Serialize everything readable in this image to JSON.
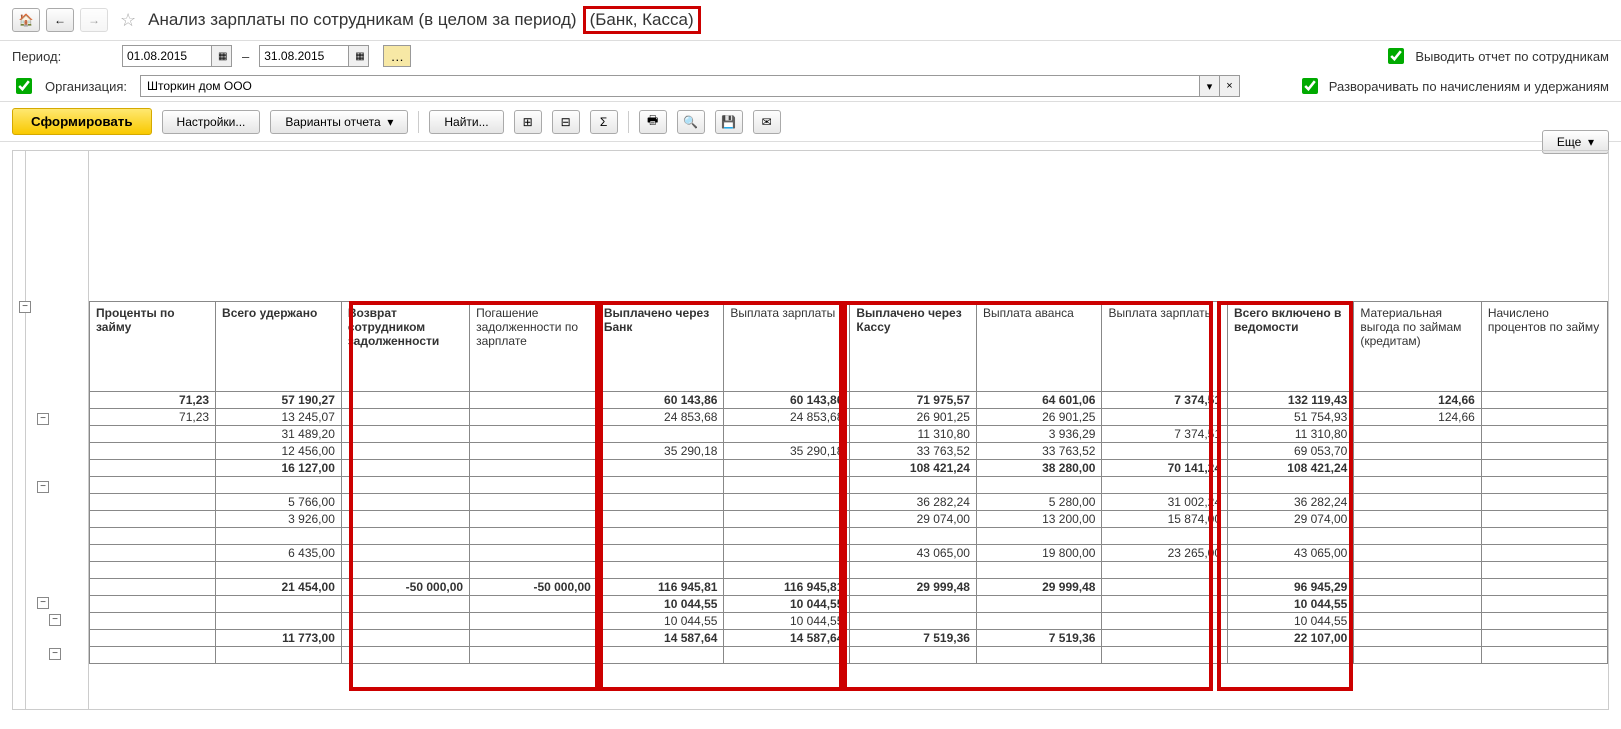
{
  "header": {
    "title_main": "Анализ зарплаты по сотрудникам (в целом за период)",
    "title_suffix": "(Банк, Касса)"
  },
  "period": {
    "label": "Период:",
    "from": "01.08.2015",
    "dash": "–",
    "to": "31.08.2015"
  },
  "org": {
    "label": "Организация:",
    "value": "Шторкин дом ООО"
  },
  "opts": {
    "by_emp": "Выводить отчет по сотрудникам",
    "expand": "Разворачивать по начислениям и удержаниям"
  },
  "actions": {
    "form": "Сформировать",
    "settings": "Настройки...",
    "variants": "Варианты отчета",
    "find": "Найти...",
    "more": "Еще"
  },
  "cols": [
    "Проценты по займу",
    "Всего удержано",
    "Возврат сотрудником задолженности",
    "Погашение задолженности по зарплате",
    "Выплачено через Банк",
    "Выплата зарплаты",
    "Выплачено через Кассу",
    "Выплата аванса",
    "Выплата зарплаты",
    "Всего включено в ведомости",
    "Материальная выгода по займам (кредитам)",
    "Начислено процентов по займу"
  ],
  "col_bold": [
    true,
    true,
    true,
    false,
    true,
    false,
    true,
    false,
    false,
    true,
    false,
    false
  ],
  "rows": [
    {
      "b": 1,
      "c": [
        "71,23",
        "57 190,27",
        "",
        "",
        "60 143,86",
        "60 143,86",
        "71 975,57",
        "64 601,06",
        "7 374,51",
        "132 119,43",
        "124,66",
        ""
      ]
    },
    {
      "b": 0,
      "c": [
        "71,23",
        "13 245,07",
        "",
        "",
        "24 853,68",
        "24 853,68",
        "26 901,25",
        "26 901,25",
        "",
        "51 754,93",
        "124,66",
        ""
      ]
    },
    {
      "b": 0,
      "c": [
        "",
        "31 489,20",
        "",
        "",
        "",
        "",
        "11 310,80",
        "3 936,29",
        "7 374,51",
        "11 310,80",
        "",
        ""
      ]
    },
    {
      "b": 0,
      "c": [
        "",
        "12 456,00",
        "",
        "",
        "35 290,18",
        "35 290,18",
        "33 763,52",
        "33 763,52",
        "",
        "69 053,70",
        "",
        ""
      ]
    },
    {
      "b": 1,
      "c": [
        "",
        "16 127,00",
        "",
        "",
        "",
        "",
        "108 421,24",
        "38 280,00",
        "70 141,24",
        "108 421,24",
        "",
        ""
      ]
    },
    {
      "b": 0,
      "c": [
        "",
        "",
        "",
        "",
        "",
        "",
        "",
        "",
        "",
        "",
        "",
        ""
      ]
    },
    {
      "b": 0,
      "c": [
        "",
        "5 766,00",
        "",
        "",
        "",
        "",
        "36 282,24",
        "5 280,00",
        "31 002,24",
        "36 282,24",
        "",
        ""
      ]
    },
    {
      "b": 0,
      "c": [
        "",
        "3 926,00",
        "",
        "",
        "",
        "",
        "29 074,00",
        "13 200,00",
        "15 874,00",
        "29 074,00",
        "",
        ""
      ]
    },
    {
      "b": 0,
      "c": [
        "",
        "",
        "",
        "",
        "",
        "",
        "",
        "",
        "",
        "",
        "",
        ""
      ]
    },
    {
      "b": 0,
      "c": [
        "",
        "6 435,00",
        "",
        "",
        "",
        "",
        "43 065,00",
        "19 800,00",
        "23 265,00",
        "43 065,00",
        "",
        ""
      ]
    },
    {
      "b": 0,
      "c": [
        "",
        "",
        "",
        "",
        "",
        "",
        "",
        "",
        "",
        "",
        "",
        ""
      ]
    },
    {
      "b": 1,
      "c": [
        "",
        "21 454,00",
        "-50 000,00",
        "-50 000,00",
        "116 945,81",
        "116 945,81",
        "29 999,48",
        "29 999,48",
        "",
        "96 945,29",
        "",
        ""
      ]
    },
    {
      "b": 1,
      "c": [
        "",
        "",
        "",
        "",
        "10 044,55",
        "10 044,55",
        "",
        "",
        "",
        "10 044,55",
        "",
        ""
      ]
    },
    {
      "b": 0,
      "c": [
        "",
        "",
        "",
        "",
        "10 044,55",
        "10 044,55",
        "",
        "",
        "",
        "10 044,55",
        "",
        ""
      ]
    },
    {
      "b": 1,
      "c": [
        "",
        "11 773,00",
        "",
        "",
        "14 587,64",
        "14 587,64",
        "7 519,36",
        "7 519,36",
        "",
        "22 107,00",
        "",
        ""
      ]
    },
    {
      "b": 0,
      "c": [
        "",
        "",
        "",
        "",
        "",
        "",
        "",
        "",
        "",
        "",
        "",
        ""
      ]
    }
  ],
  "tree": {
    "minus": "−",
    "plus": "+"
  }
}
